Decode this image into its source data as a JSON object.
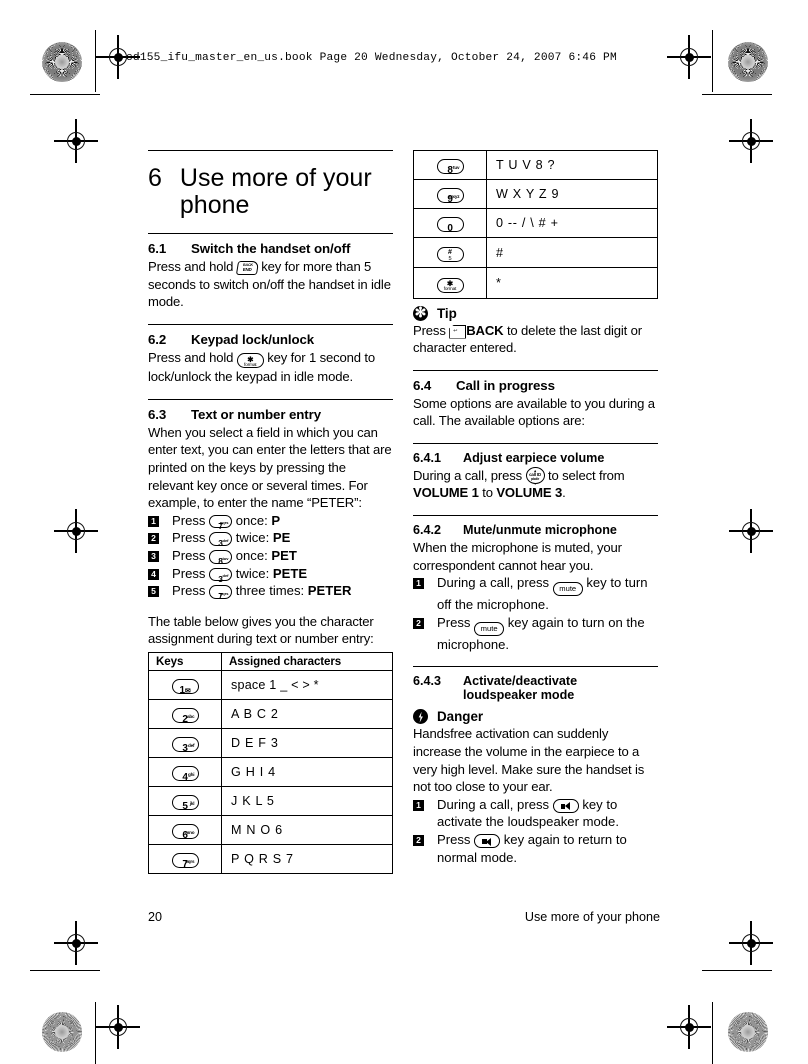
{
  "print_header": "cd155_ifu_master_en_us.book  Page 20  Wednesday, October 24, 2007  6:46 PM",
  "chapter": {
    "number": "6",
    "title": "Use more of your phone"
  },
  "sections": {
    "s61": {
      "number": "6.1",
      "title": "Switch the handset on/off",
      "text_a": "Press and hold ",
      "text_b": " key for more than 5 seconds to switch on/off the handset in idle mode."
    },
    "s62": {
      "number": "6.2",
      "title": "Keypad lock/unlock",
      "text_a": "Press and hold ",
      "text_b": " key for 1 second to lock/unlock the keypad in idle mode."
    },
    "s63": {
      "number": "6.3",
      "title": "Text or number entry",
      "intro": "When you select a field in which you can enter text, you can enter the letters that are printed on the keys by pressing the relevant key once or several times. For example, to enter the name “PETER”:",
      "steps": [
        {
          "pre": "Press ",
          "key_digit": "7",
          "key_sub": "pqrs",
          "post": " once: ",
          "result": "P"
        },
        {
          "pre": "Press ",
          "key_digit": "3",
          "key_sub": "def",
          "post": " twice: ",
          "result": "PE"
        },
        {
          "pre": "Press ",
          "key_digit": "8",
          "key_sub": "tuv",
          "post": " once: ",
          "result": "PET"
        },
        {
          "pre": "Press ",
          "key_digit": "3",
          "key_sub": "def",
          "post": " twice: ",
          "result": "PETE"
        },
        {
          "pre": "Press ",
          "key_digit": "7",
          "key_sub": "pqrs",
          "post": " three times: ",
          "result": "PETER"
        }
      ],
      "table_intro": "The table below gives you the character assignment during text or number entry:"
    },
    "s64": {
      "number": "6.4",
      "title": "Call in progress",
      "text": "Some options are available to you during a call. The available options are:"
    },
    "s641": {
      "number": "6.4.1",
      "title": "Adjust earpiece volume",
      "text_a": "During a call, press ",
      "text_b": " to select from ",
      "vol_low": "VOLUME 1",
      "text_c": " to ",
      "vol_high": "VOLUME 3",
      "text_d": "."
    },
    "s642": {
      "number": "6.4.2",
      "title": "Mute/unmute microphone",
      "text": "When the microphone is muted, your correspondent cannot hear you.",
      "steps": [
        {
          "pre": "During a call, press ",
          "key": "mute",
          "post": " key to turn off the microphone."
        },
        {
          "pre": "Press ",
          "key": "mute",
          "post": " key again to turn on the microphone."
        }
      ]
    },
    "s643": {
      "number": "6.4.3",
      "title_line1": "Activate/deactivate",
      "title_line2": "loudspeaker mode",
      "danger_label": "Danger",
      "danger_text": "Handsfree activation can suddenly increase the volume in the earpiece to a very high level. Make sure the handset is not too close to your ear.",
      "steps": [
        {
          "pre": "During a call, press ",
          "post": " key to activate the loudspeaker mode."
        },
        {
          "pre": "Press ",
          "post": " key again to return to normal mode."
        }
      ]
    }
  },
  "tip": {
    "label": "Tip",
    "text_a": "Press ",
    "back_label": "BACK",
    "text_b": " to delete the last digit or character entered."
  },
  "key_table": {
    "header_keys": "Keys",
    "header_chars": "Assigned characters",
    "rows": [
      {
        "digit": "1",
        "sub": "envelope",
        "chars": "space 1 _ < > *"
      },
      {
        "digit": "2",
        "sub": "abc",
        "chars": "A B C 2"
      },
      {
        "digit": "3",
        "sub": "def",
        "chars": "D E F 3"
      },
      {
        "digit": "4",
        "sub": "ghi",
        "chars": "G H I 4"
      },
      {
        "digit": "5",
        "sub": "jkl",
        "chars": "J K L 5"
      },
      {
        "digit": "6",
        "sub": "mno",
        "chars": "M N O 6"
      },
      {
        "digit": "7",
        "sub": "pqrs",
        "chars": "P Q R S 7"
      },
      {
        "digit": "8",
        "sub": "tuv",
        "chars": "T U V 8 ?"
      },
      {
        "digit": "9",
        "sub": "wxyz",
        "chars": "W X Y Z 9"
      },
      {
        "digit": "0",
        "sub": "",
        "chars": "0 -- / \\ # +"
      },
      {
        "digit": "#",
        "sub": "5",
        "chars": "#"
      },
      {
        "digit": "*",
        "sub": "format",
        "chars": "*"
      }
    ]
  },
  "footer": {
    "page_number": "20",
    "running_title": "Use more of your phone"
  }
}
